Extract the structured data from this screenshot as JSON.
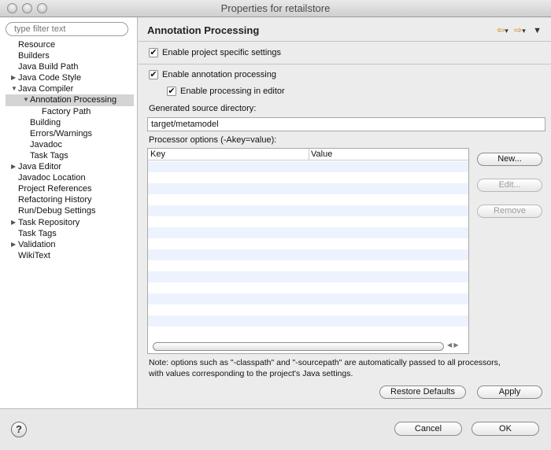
{
  "window": {
    "title": "Properties for retailstore"
  },
  "filter": {
    "placeholder": "type filter text"
  },
  "tree": [
    {
      "label": "Resource",
      "level": 1,
      "expander": ""
    },
    {
      "label": "Builders",
      "level": 1,
      "expander": ""
    },
    {
      "label": "Java Build Path",
      "level": 1,
      "expander": ""
    },
    {
      "label": "Java Code Style",
      "level": 1,
      "expander": "collapsed"
    },
    {
      "label": "Java Compiler",
      "level": 1,
      "expander": "expanded"
    },
    {
      "label": "Annotation Processing",
      "level": 2,
      "expander": "expanded",
      "selected": true
    },
    {
      "label": "Factory Path",
      "level": 3,
      "expander": ""
    },
    {
      "label": "Building",
      "level": 2,
      "expander": ""
    },
    {
      "label": "Errors/Warnings",
      "level": 2,
      "expander": ""
    },
    {
      "label": "Javadoc",
      "level": 2,
      "expander": ""
    },
    {
      "label": "Task Tags",
      "level": 2,
      "expander": ""
    },
    {
      "label": "Java Editor",
      "level": 1,
      "expander": "collapsed"
    },
    {
      "label": "Javadoc Location",
      "level": 1,
      "expander": ""
    },
    {
      "label": "Project References",
      "level": 1,
      "expander": ""
    },
    {
      "label": "Refactoring History",
      "level": 1,
      "expander": ""
    },
    {
      "label": "Run/Debug Settings",
      "level": 1,
      "expander": ""
    },
    {
      "label": "Task Repository",
      "level": 1,
      "expander": "collapsed"
    },
    {
      "label": "Task Tags",
      "level": 1,
      "expander": ""
    },
    {
      "label": "Validation",
      "level": 1,
      "expander": "collapsed"
    },
    {
      "label": "WikiText",
      "level": 1,
      "expander": ""
    }
  ],
  "page": {
    "title": "Annotation Processing",
    "enable_project_specific": "Enable project specific settings",
    "enable_annotation_processing": "Enable annotation processing",
    "enable_processing_in_editor": "Enable processing in editor",
    "generated_source_dir_label": "Generated source directory:",
    "generated_source_dir_value": "target/metamodel",
    "processor_options_label": "Processor options (-Akey=value):",
    "table_headers": [
      "Key",
      "Value"
    ],
    "btn_new": "New...",
    "btn_edit": "Edit...",
    "btn_remove": "Remove",
    "note_line1": "Note: options such as \"-classpath\" and \"-sourcepath\" are automatically passed to all processors,",
    "note_line2": "with values corresponding to the project's Java settings.",
    "btn_restore_defaults": "Restore Defaults",
    "btn_apply": "Apply"
  },
  "footer": {
    "help": "?",
    "cancel": "Cancel",
    "ok": "OK"
  },
  "icons": {
    "back": "back-arrow-icon",
    "forward": "forward-arrow-icon",
    "menu": "view-menu-icon"
  }
}
